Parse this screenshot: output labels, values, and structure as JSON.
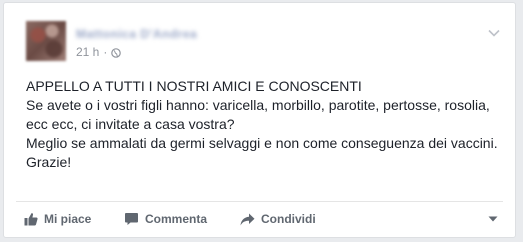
{
  "post": {
    "author_name": "Mattonica D'Andrea",
    "timestamp": "21 h",
    "separator": "·",
    "audience_icon": "globe-icon",
    "options_icon": "chevron-down-icon",
    "text_lines": [
      "APPELLO A TUTTI I NOSTRI AMICI E CONOSCENTI",
      "Se avete o i vostri figli hanno: varicella, morbillo, parotite, pertosse, rosolia, ecc ecc, ci invitate a casa vostra?",
      "Meglio se ammalati da germi selvaggi e non come conseguenza dei vaccini.",
      "Grazie!"
    ]
  },
  "actions": {
    "like_label": "Mi piace",
    "like_icon": "thumbs-up-icon",
    "comment_label": "Commenta",
    "comment_icon": "comment-icon",
    "share_label": "Condividi",
    "share_icon": "share-arrow-icon",
    "menu_icon": "caret-down-icon"
  },
  "colors": {
    "background": "#e9ebee",
    "card": "#ffffff",
    "text": "#1d2129",
    "meta_text": "#90949c",
    "action_text": "#606770"
  }
}
